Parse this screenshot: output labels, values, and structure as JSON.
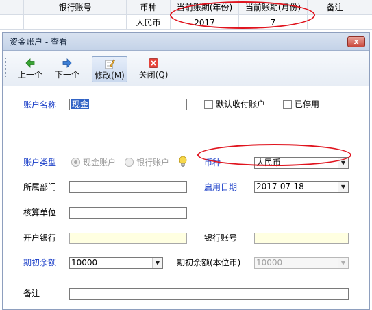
{
  "background_table": {
    "headers": [
      "银行账号",
      "币种",
      "当前账期(年份)",
      "当前账期(月份)",
      "备注"
    ],
    "row": [
      "",
      "人民币",
      "2017",
      "7",
      ""
    ]
  },
  "dialog": {
    "title": "资金账户 - 查看",
    "close_label": "x"
  },
  "toolbar": {
    "prev_label": "上一个",
    "next_label": "下一个",
    "edit_label": "修改(M)",
    "close_label": "关闭(Q)"
  },
  "form": {
    "account_name_label": "账户名称",
    "account_name_value": "现金",
    "default_receipt_label": "默认收付账户",
    "disabled_label": "已停用",
    "account_type_label": "账户类型",
    "cash_account_label": "现金账户",
    "bank_account_label": "银行账户",
    "currency_label": "币种",
    "currency_value": "人民币",
    "department_label": "所属部门",
    "department_value": "",
    "start_date_label": "启用日期",
    "start_date_value": "2017-07-18",
    "accounting_unit_label": "核算单位",
    "accounting_unit_value": "",
    "bank_label": "开户银行",
    "bank_value": "",
    "bank_account_no_label": "银行账号",
    "bank_account_no_value": "",
    "opening_balance_label": "期初余额",
    "opening_balance_value": "10000",
    "opening_balance_base_label": "期初余额(本位币)",
    "opening_balance_base_value": "10000",
    "remarks_label": "备注",
    "remarks_value": ""
  },
  "colors": {
    "required_label": "#1a3ec8",
    "annotation_red": "#e0141e",
    "readonly_yellow": "#ffffe1"
  }
}
